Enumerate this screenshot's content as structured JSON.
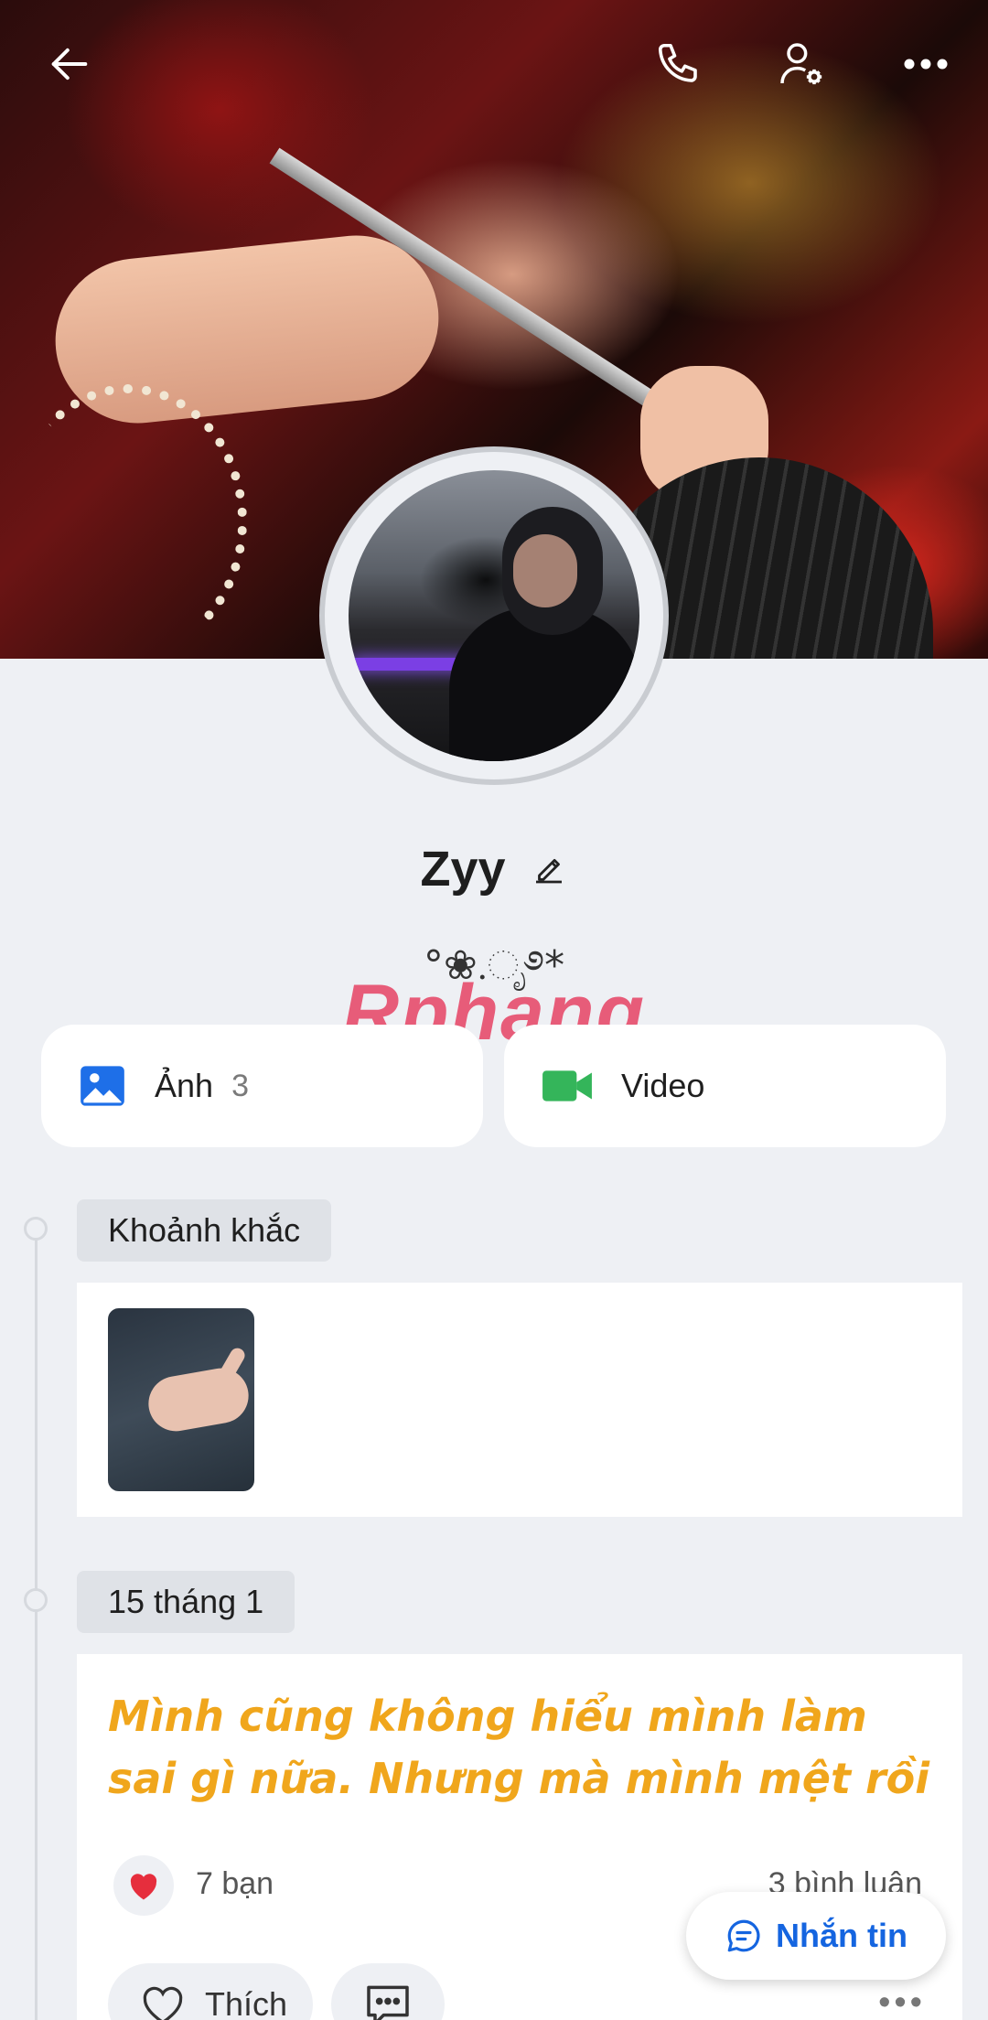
{
  "cover": {
    "top_bar": {
      "back_icon": "arrow-left-icon",
      "call_icon": "phone-icon",
      "settings_icon": "user-settings-icon",
      "more_icon": "more-horizontal-icon"
    }
  },
  "profile": {
    "name": "Zyy",
    "status": "°❀.ೃ࿔*"
  },
  "watermark": "Rphang",
  "media_cards": [
    {
      "label": "Ảnh",
      "count": "3",
      "icon": "image-icon",
      "color": "#1e6fe8"
    },
    {
      "label": "Video",
      "icon": "video-icon",
      "color": "#34b55a"
    }
  ],
  "timeline": {
    "moments_label": "Khoảnh khắc",
    "date_label": "15 tháng 1",
    "post": {
      "text": "Mình cũng không hiểu mình làm sai gì nữa. Nhưng mà mình mệt rồi",
      "reaction_count": "7 bạn",
      "comment_count": "3 bình luận",
      "like_label": "Thích",
      "more": "•••"
    }
  },
  "fab": {
    "label": "Nhắn tin"
  }
}
